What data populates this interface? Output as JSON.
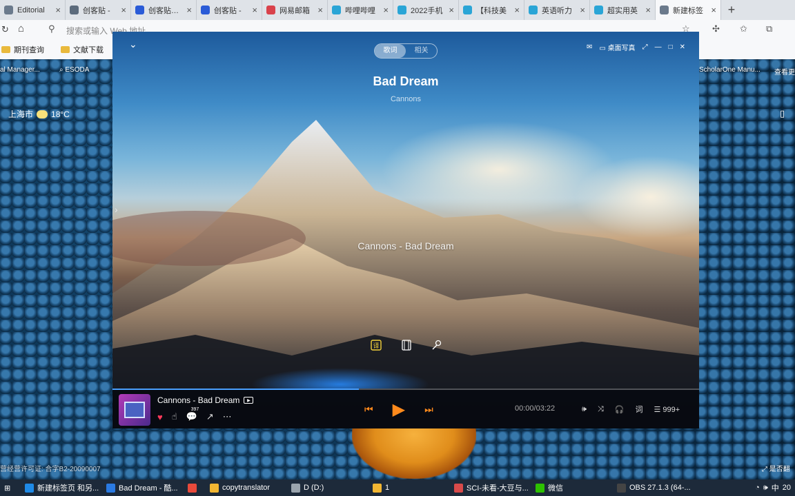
{
  "browser": {
    "tabs": [
      {
        "label": "Editorial",
        "icon": "page-icon",
        "color": "#6b7a8c"
      },
      {
        "label": "创客贴 -",
        "icon": "search-icon",
        "color": "#5c6b7c"
      },
      {
        "label": "创客贴_广",
        "icon": "chuangketie-icon",
        "color": "#2a5bd7"
      },
      {
        "label": "创客贴 -",
        "icon": "chuangketie-icon",
        "color": "#2a5bd7"
      },
      {
        "label": "网易邮箱",
        "icon": "netease-mail-icon",
        "color": "#d9424b"
      },
      {
        "label": "哔哩哔哩",
        "icon": "bilibili-icon",
        "color": "#2aa5d6"
      },
      {
        "label": "2022手机",
        "icon": "bilibili-icon",
        "color": "#2aa5d6"
      },
      {
        "label": "【科技美",
        "icon": "bilibili-icon",
        "color": "#2aa5d6"
      },
      {
        "label": "英语听力",
        "icon": "bilibili-icon",
        "color": "#2aa5d6"
      },
      {
        "label": "超实用英",
        "icon": "bilibili-icon",
        "color": "#2aa5d6"
      },
      {
        "label": "新建标签",
        "icon": "page-icon",
        "color": "#6b7a8c",
        "active": true
      }
    ],
    "address_placeholder": "搜索或输入 Web 地址",
    "bookmarks": [
      "期刊查询",
      "文献下载"
    ],
    "page_items": [
      "al Manager...",
      "ESODA",
      "ScholarOne Manu...",
      "查看更"
    ],
    "weather_city": "上海市",
    "weather_temp": "18°C",
    "license": "营经营许可证: 合字B2-20090007",
    "is_text": "是否翻"
  },
  "player": {
    "tab_lyrics": "歌词",
    "tab_related": "相关",
    "desktop_photo": "桌面写真",
    "title": "Bad Dream",
    "artist": "Cannons",
    "lyric_line": "Cannons - Bad Dream",
    "now_playing": "Cannons - Bad Dream",
    "comment_count": "397",
    "time": "00:00/03:22",
    "lyric_btn": "词",
    "playlist_count": "999+",
    "progress": 0.42,
    "accent": "#ff8a1c"
  },
  "taskbar": {
    "items": [
      {
        "label": "新建标签页 和另...",
        "color": "#1f8ae6"
      },
      {
        "label": "Bad Dream - 酷...",
        "color": "#2a7ae2"
      },
      {
        "label": "",
        "color": "#e94a3b"
      },
      {
        "label": "copytranslator",
        "color": "#f2b632"
      },
      {
        "label": "D (D:)",
        "color": "#9aa4ad"
      },
      {
        "label": "1",
        "color": "#f2b632"
      },
      {
        "label": "SCI-未看-大豆与...",
        "color": "#d84a4a"
      },
      {
        "label": "微信",
        "color": "#2dc100"
      },
      {
        "label": "OBS 27.1.3 (64-...",
        "color": "#444"
      }
    ],
    "ime": "中",
    "clock": "20"
  }
}
